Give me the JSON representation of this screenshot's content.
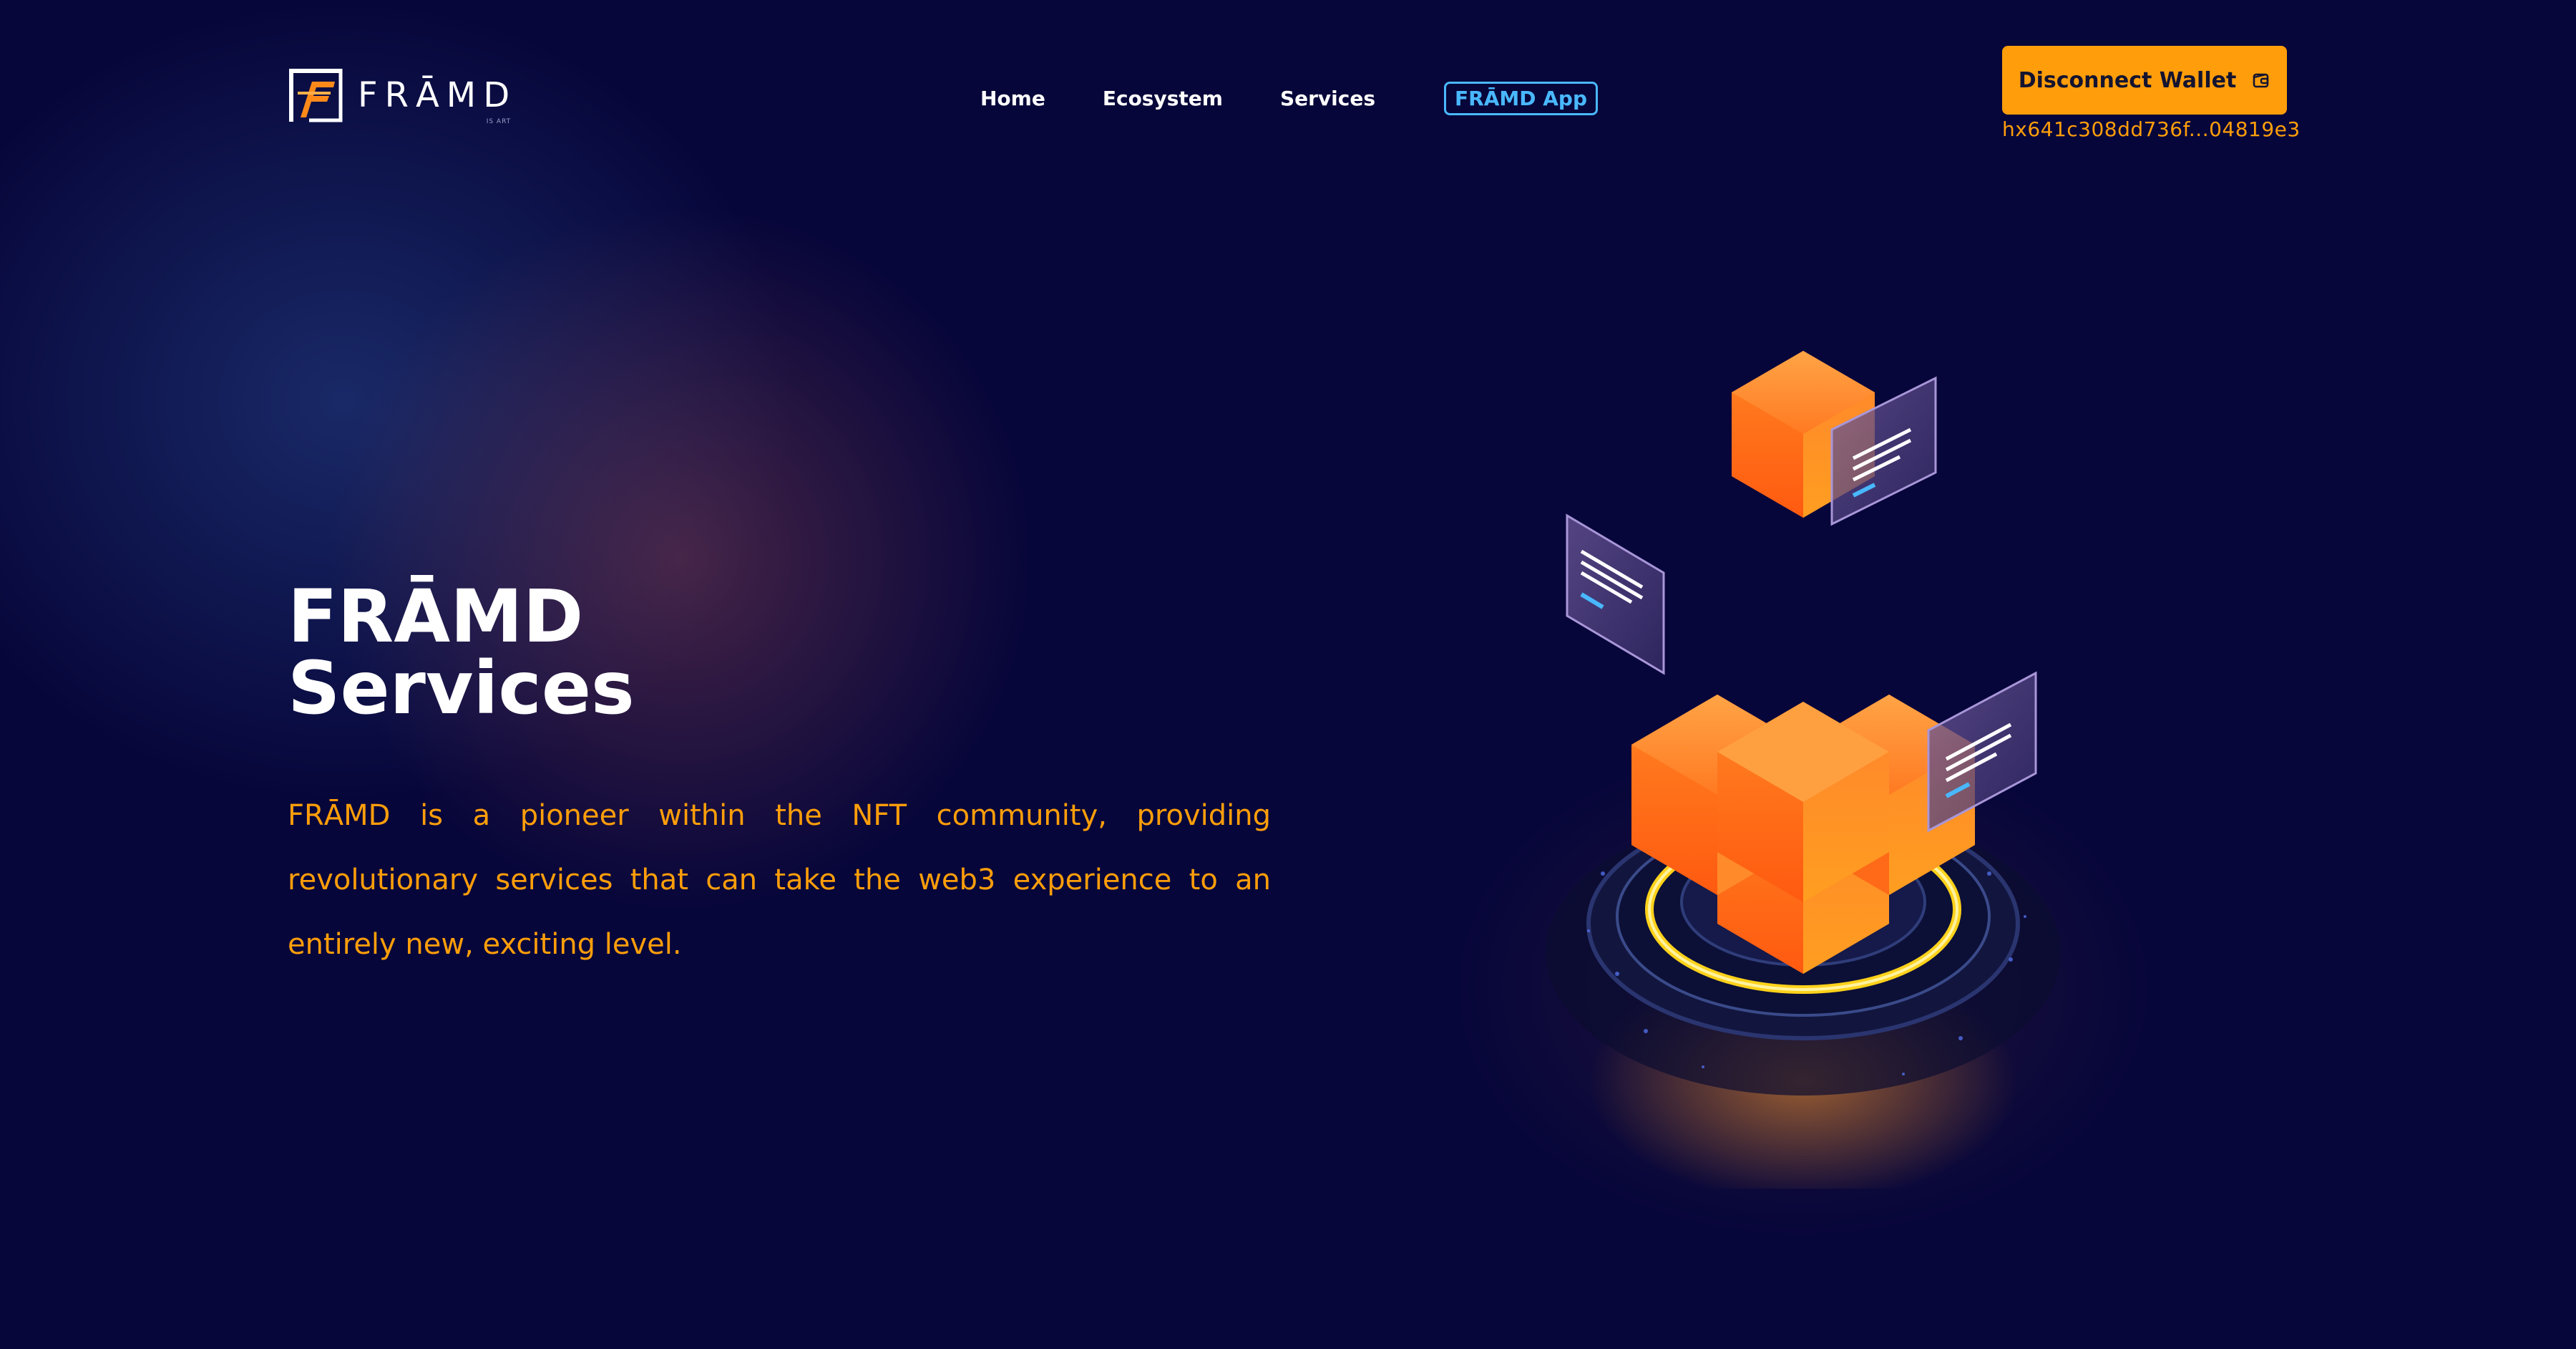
{
  "header": {
    "logo_text": "FRĀMD",
    "logo_sub": "IS ART",
    "nav": [
      {
        "label": "Home"
      },
      {
        "label": "Ecosystem"
      },
      {
        "label": "Services"
      }
    ],
    "app_link": "FRĀMD App",
    "wallet_button": "Disconnect Wallet",
    "wallet_address": "hx641c308dd736f...04819e3"
  },
  "hero": {
    "title_line1": "FRĀMD",
    "title_line2": "Services",
    "description": "FRĀMD is a pioneer within the NFT community, providing revolutionary services that can take the web3 experience to an entirely new, exciting level."
  },
  "icons": {
    "logo": "framd-logo-icon",
    "wallet": "wallet-icon",
    "illustration": "orange-cubes-illustration"
  },
  "colors": {
    "background": "#07063a",
    "accent": "#ff9e0a",
    "app_link": "#49b8ff",
    "text": "#ffffff"
  }
}
